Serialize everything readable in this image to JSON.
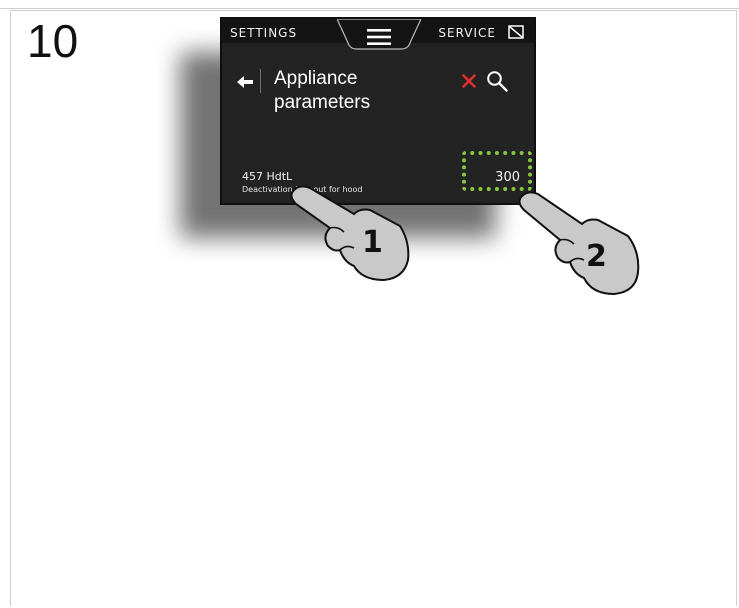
{
  "step": {
    "number": "10"
  },
  "screen": {
    "topbar": {
      "settings_label": "SETTINGS",
      "service_label": "SERVICE",
      "menu_icon": "hamburger-menu-icon",
      "service_icon": "service-crossed-square-icon"
    },
    "header": {
      "back_icon": "left-arrow-icon",
      "title": "Appliance parameters",
      "close_icon": "close-x-icon",
      "search_icon": "search-icon"
    },
    "parameter": {
      "code": "457 HdtL",
      "description": "Deactivation timeout for hood",
      "value": "300"
    },
    "colors": {
      "screen_bg": "#232323",
      "close_red": "#e0302e",
      "highlight_green": "#8bc53f"
    }
  },
  "callouts": [
    {
      "number": "1",
      "icon": "pointing-hand-icon"
    },
    {
      "number": "2",
      "icon": "pointing-hand-icon"
    }
  ]
}
